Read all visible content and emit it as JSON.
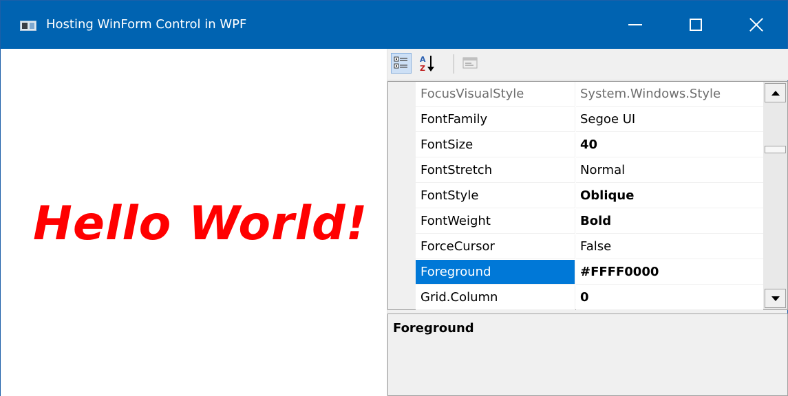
{
  "window": {
    "title": "Hosting WinForm Control in WPF",
    "title_bar_color": "#0063B1",
    "buttons": [
      "minimize-icon",
      "maximize-icon",
      "close-icon"
    ]
  },
  "left_pane": {
    "text": "Hello World!",
    "text_color": "#FF0000"
  },
  "property_grid": {
    "toolbar": {
      "buttons": [
        "categorized-icon",
        "alphabetical-sort-icon",
        "property-pages-icon"
      ],
      "active": "categorized-icon"
    },
    "rows": [
      {
        "name": "FocusVisualStyle",
        "value": "System.Windows.Style",
        "dim": true,
        "bold": false
      },
      {
        "name": "FontFamily",
        "value": "Segoe UI",
        "bold": false
      },
      {
        "name": "FontSize",
        "value": "40",
        "bold": true
      },
      {
        "name": "FontStretch",
        "value": "Normal",
        "bold": false
      },
      {
        "name": "FontStyle",
        "value": "Oblique",
        "bold": true
      },
      {
        "name": "FontWeight",
        "value": "Bold",
        "bold": true
      },
      {
        "name": "ForceCursor",
        "value": "False",
        "bold": false
      },
      {
        "name": "Foreground",
        "value": "#FFFF0000",
        "bold": true,
        "selected": true
      },
      {
        "name": "Grid.Column",
        "value": "0",
        "bold": true
      }
    ],
    "selected_color": "#0078D7",
    "description": {
      "title": "Foreground"
    }
  }
}
